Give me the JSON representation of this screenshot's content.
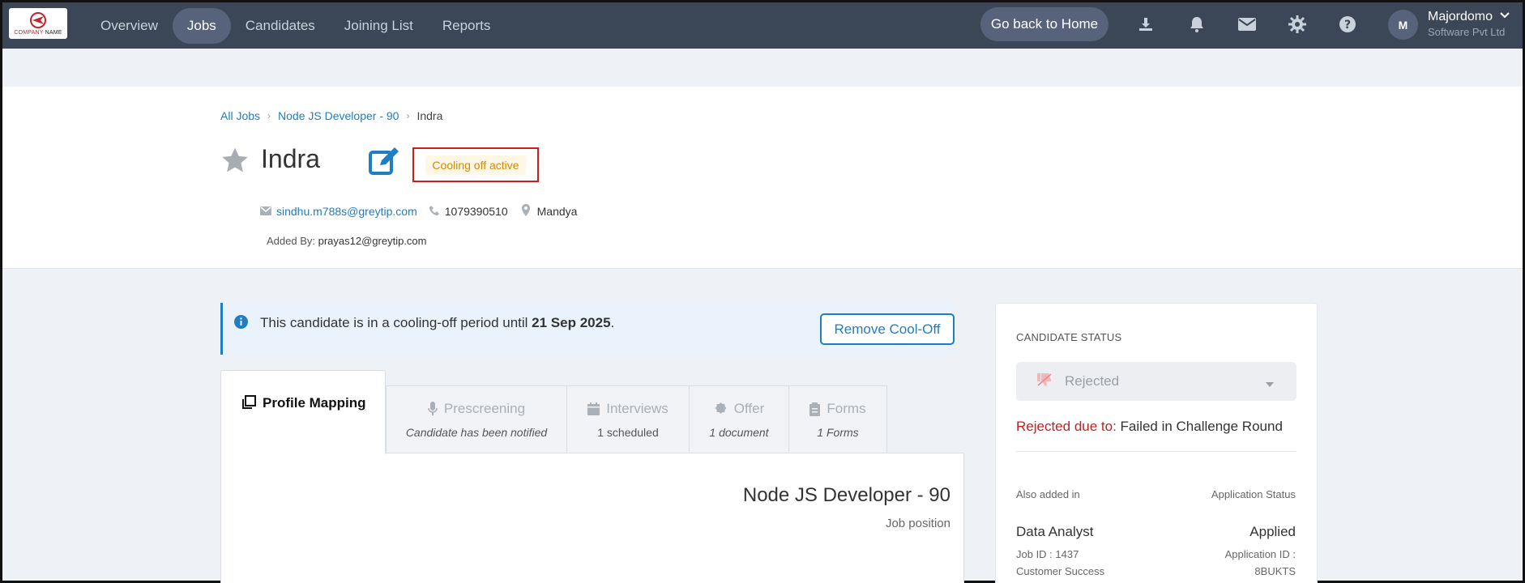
{
  "brand": {
    "logo_text_red": "COMPANY",
    "logo_text_dark": "NAME"
  },
  "nav": {
    "items": [
      {
        "label": "Overview"
      },
      {
        "label": "Jobs"
      },
      {
        "label": "Candidates"
      },
      {
        "label": "Joining List"
      },
      {
        "label": "Reports"
      }
    ],
    "active": "Jobs",
    "home_button": "Go back to Home"
  },
  "user": {
    "initial": "M",
    "name": "Majordomo",
    "org": "Software Pvt Ltd"
  },
  "breadcrumb": {
    "root": "All Jobs",
    "job": "Node JS Developer - 90",
    "current": "Indra"
  },
  "candidate": {
    "name": "Indra",
    "badge": "Cooling off active",
    "email": "sindhu.m788s@greytip.com",
    "phone": "1079390510",
    "location": "Mandya",
    "added_by_label": "Added By:",
    "added_by": "prayas12@greytip.com"
  },
  "notice": {
    "text": "This candidate is in a cooling-off period until",
    "date": "21 Sep 2025",
    "suffix": ".",
    "button": "Remove Cool-Off"
  },
  "tabs": [
    {
      "label": "Profile Mapping",
      "sub": "",
      "icon": "copy-icon"
    },
    {
      "label": "Prescreening",
      "sub": "Candidate has been notified",
      "icon": "microphone-icon"
    },
    {
      "label": "Interviews",
      "sub": "1 scheduled",
      "icon": "calendar-icon"
    },
    {
      "label": "Offer",
      "sub": "1 document",
      "icon": "badge-icon"
    },
    {
      "label": "Forms",
      "sub": "1 Forms",
      "icon": "clipboard-icon"
    }
  ],
  "content": {
    "job_title": "Node JS Developer - 90",
    "job_subtitle": "Job position"
  },
  "status_card": {
    "title": "CANDIDATE STATUS",
    "status": "Rejected",
    "reject_label": "Rejected due to:",
    "reject_reason": "Failed in Challenge Round",
    "also_added": "Also added in",
    "application_status": "Application Status",
    "other_job": {
      "name": "Data Analyst",
      "status": "Applied",
      "job_id": "Job ID : 1437",
      "app_id_label": "Application ID :",
      "department": "Customer Success",
      "app_id": "8BUKTS"
    }
  },
  "colors": {
    "nav_bg": "#3b4756",
    "link": "#1f7dc1",
    "danger": "#c81e1e",
    "warning": "#d48806"
  }
}
